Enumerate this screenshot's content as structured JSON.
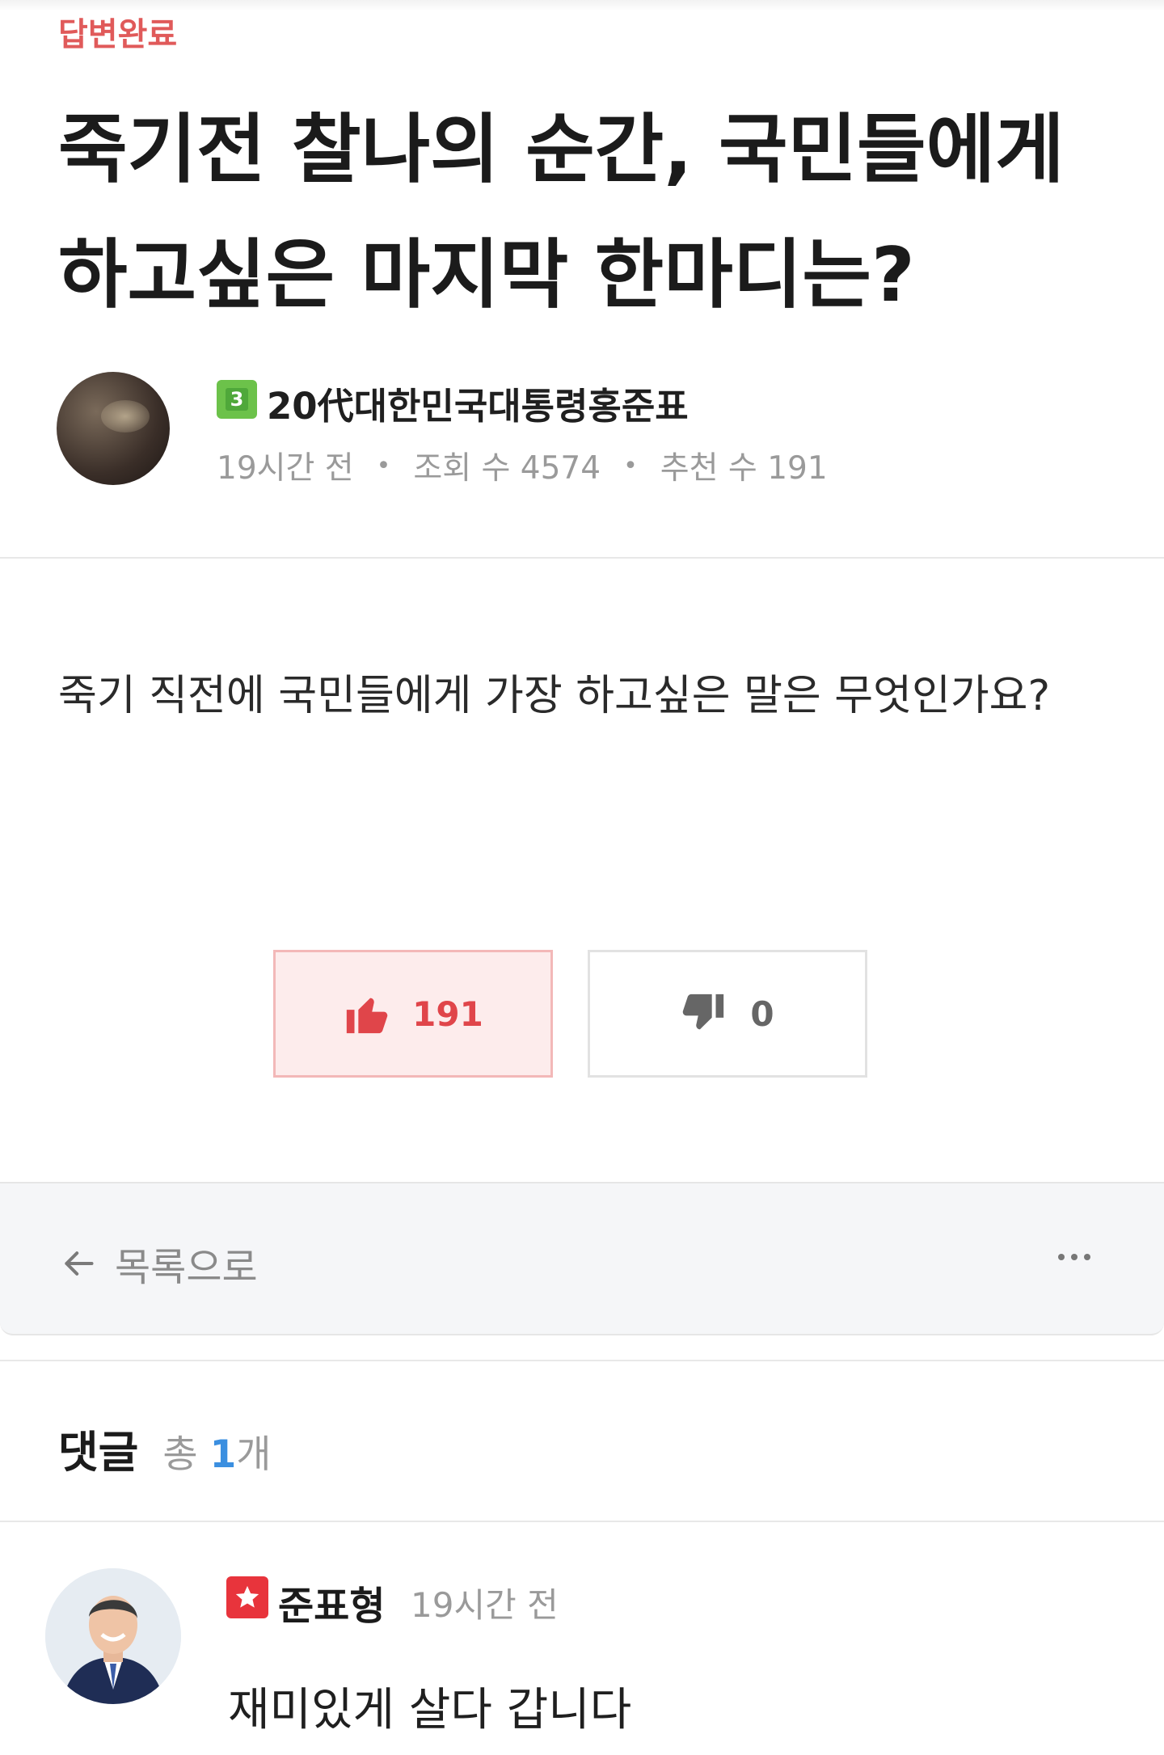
{
  "post": {
    "status_label": "답변완료",
    "title": "죽기전 찰나의 순간, 국민들에게 하고싶은 마지막 한마디는?",
    "author": {
      "level_badge": "3",
      "name": "20代대한민국대통령홍준표"
    },
    "meta": {
      "time": "19시간 전",
      "views": "조회 수 4574",
      "recommends": "추천 수 191",
      "separator": "•"
    },
    "body": "죽기 직전에 국민들에게 가장 하고싶은 말은 무엇인가요?",
    "votes": {
      "up": "191",
      "down": "0"
    }
  },
  "footer": {
    "back_label": "목록으로"
  },
  "comments": {
    "title": "댓글",
    "count_prefix": "총",
    "count": "1",
    "count_suffix": "개",
    "items": [
      {
        "name": "준표형",
        "time": "19시간 전",
        "text": "재미있게 살다 갑니다"
      }
    ]
  },
  "colors": {
    "status": "#e05a5a",
    "vote_up": "#e0454a",
    "count_accent": "#3b8fe0",
    "level_badge": "#6cc24a",
    "star_badge": "#e8343c"
  },
  "icons": [
    "thumbs-up-icon",
    "thumbs-down-icon",
    "arrow-left-icon",
    "more-dots-icon",
    "star-icon"
  ]
}
